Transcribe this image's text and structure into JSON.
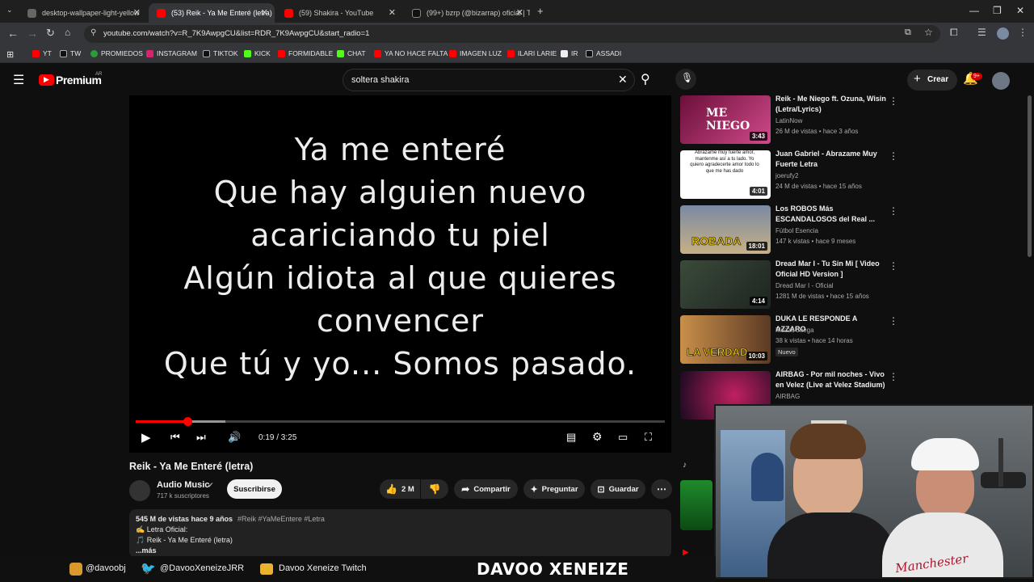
{
  "browser": {
    "tabs": [
      {
        "label": "desktop-wallpaper-light-yellow",
        "active": false
      },
      {
        "label": "(53) Reik - Ya Me Enteré (letra)",
        "active": true
      },
      {
        "label": "(59) Shakira - YouTube",
        "active": false
      },
      {
        "label": "(99+) bzrp (@bizarrap) oficial | T",
        "active": false
      }
    ],
    "url": "youtube.com/watch?v=R_7K9AwpgCU&list=RDR_7K9AwpgCU&start_radio=1",
    "bookmarks": [
      "YT",
      "TW",
      "PROMIEDOS",
      "INSTAGRAM",
      "TIKTOK",
      "KICK",
      "FORMIDABLE",
      "CHAT",
      "YA NO HACE FALTA",
      "IMAGEN LUZ",
      "ILARI LARIE",
      "IR",
      "ASSADI"
    ]
  },
  "youtube": {
    "logo": "Premium",
    "region": "AR",
    "search_value": "soltera shakira",
    "create_label": "Crear",
    "notif_count": "9+"
  },
  "video": {
    "lyrics": [
      "Ya me enteré",
      "Que hay alguien nuevo",
      "acariciando tu piel",
      "Algún idiota al que quieres",
      "convencer",
      "Que tú y yo... Somos pasado."
    ],
    "time": "0:19 / 3:25",
    "progress": 0.097,
    "buffered": 0.17,
    "title": "Reik - Ya Me Enteré (letra)",
    "channel": "Audio Music",
    "subscribers": "717 k suscriptores",
    "subscribe_label": "Suscribirse",
    "likes": "2 M",
    "share_label": "Compartir",
    "ask_label": "Preguntar",
    "save_label": "Guardar",
    "description": {
      "stats": "545 M de vistas  hace 9 años",
      "tags": "#Reik #YaMeEntere #Letra",
      "line1": "✍️ Letra Oficial:",
      "line2": "🎵 Reik - Ya Me Enteré (letra)",
      "more": "...más"
    }
  },
  "sidebar": {
    "items": [
      {
        "title": "Reik - Me Niego ft. Ozuna, Wisin (Letra/Lyrics)",
        "channel": "LatinNow",
        "meta": "26 M de vistas • hace 3 años",
        "duration": "3:43",
        "thumb_text": "ME NIEGO",
        "badge": ""
      },
      {
        "title": "Juan Gabriel - Abrazame Muy Fuerte Letra",
        "channel": "joerufy2",
        "meta": "24 M de vistas • hace 15 años",
        "duration": "4:01",
        "thumb_text": "Abrázame muy fuerte amor, mantenme así a tu lado. Yo quiero agradecerte amor todo lo que me has dado",
        "badge": ""
      },
      {
        "title": "Los ROBOS Más ESCANDALOSOS del Real ...",
        "channel": "Fútbol Esencia",
        "meta": "147 k vistas • hace 9 meses",
        "duration": "18:01",
        "thumb_text": "ROBADA",
        "badge": ""
      },
      {
        "title": "Dread Mar I - Tu Sin Mi [ Video Oficial HD Version ]",
        "channel": "Dread Mar I - Oficial",
        "meta": "1281 M de vistas • hace 15 años",
        "duration": "4:14",
        "thumb_text": "",
        "badge": ""
      },
      {
        "title": "DUKA LE RESPONDE A AZZARO",
        "channel": "Muzzu Juega",
        "meta": "38 k vistas • hace 14 horas",
        "duration": "10:03",
        "thumb_text": "LA VERDAD",
        "badge": "Nuevo"
      },
      {
        "title": "AIRBAG - Por mil noches - Vivo en Velez (Live at Velez Stadium)",
        "channel": "AIRBAG",
        "meta": "",
        "duration": "",
        "thumb_text": "",
        "badge": ""
      }
    ]
  },
  "stream_overlay": {
    "instagram": "@davoobj",
    "twitter": "@DavooXeneizeJRR",
    "twitch": "Davoo Xeneize Twitch",
    "brand": "DAVOO XENEIZE",
    "shirt_text": "Manchester"
  }
}
